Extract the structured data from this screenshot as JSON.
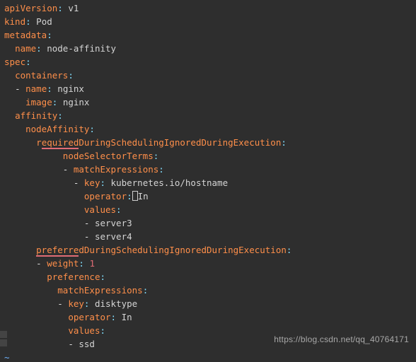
{
  "yaml": {
    "apiVersion": {
      "k": "apiVersion",
      "v": "v1"
    },
    "kind": {
      "k": "kind",
      "v": "Pod"
    },
    "metadata": {
      "k": "metadata"
    },
    "name": {
      "k": "name",
      "v": "node-affinity"
    },
    "spec": {
      "k": "spec"
    },
    "containers": {
      "k": "containers"
    },
    "c_name": {
      "k": "name",
      "v": "nginx"
    },
    "c_image": {
      "k": "image",
      "v": "nginx"
    },
    "affinity": {
      "k": "affinity"
    },
    "nodeAffinity": {
      "k": "nodeAffinity"
    },
    "required": {
      "k": "requiredDuringSchedulingIgnoredDuringExecution"
    },
    "nodeSelectorTerms": {
      "k": "nodeSelectorTerms"
    },
    "matchExpressions": {
      "k": "matchExpressions"
    },
    "key1": {
      "k": "key",
      "v": "kubernetes.io/hostname"
    },
    "operator1": {
      "k": "operator",
      "v": "In"
    },
    "values1": {
      "k": "values"
    },
    "val1a": "server3",
    "val1b": "server4",
    "preferred": {
      "k": "preferredDuringSchedulingIgnoredDuringExecution"
    },
    "weight": {
      "k": "weight",
      "v": "1"
    },
    "preference": {
      "k": "preference"
    },
    "matchExpressions2": {
      "k": "matchExpressions"
    },
    "key2": {
      "k": "key",
      "v": "disktype"
    },
    "operator2": {
      "k": "operator",
      "v": "In"
    },
    "values2": {
      "k": "values"
    },
    "val2a": "ssd"
  },
  "watermark": "https://blog.csdn.net/qq_40764171",
  "tilde": "~"
}
